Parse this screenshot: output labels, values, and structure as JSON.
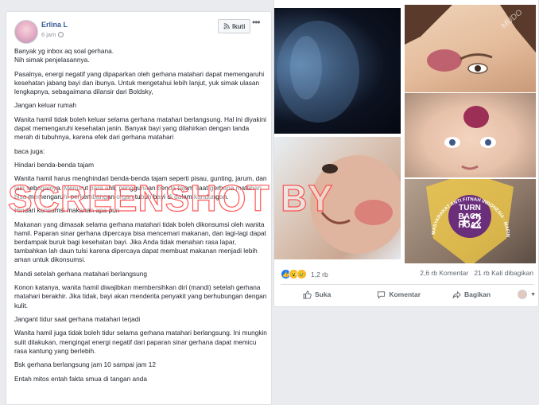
{
  "post": {
    "author": "Erlina L",
    "time": "6 jam",
    "follow_label": "Ikuti",
    "paragraphs": [
      "Banyak yg inbox aq soal gerhana.\nNih simak penjelasannya.",
      "Pasalnya, energi negatif yang dipaparkan oleh gerhana matahari dapat memengaruhi kesehatan jabang bayi dan ibunya. Untuk mengetahui lebih lanjut, yuk simak ulasan lengkapnya, sebagaimana dilansir dari Boldsky,",
      "Jangan keluar rumah",
      "Wanita hamil tidak boleh keluar selama gerhana matahari berlangsung. Hal ini diyakini dapat memengaruhi kesehatan janin. Banyak bayi yang dilahirkan dengan tanda merah di tubuhnya, karena efek dari gerhana matahari",
      "baca juga:",
      "Hindari benda-benda tajam",
      "Wanita hamil harus menghindari benda-benda tajam seperti pisau, gunting, jarum, dan lain sebagainya. Menurut para ahli, penggunaan benda tajam saat gerhana matahari bisa memengaruhi perkembangan organ tubuh bayi di dalam kandungan.",
      "Hindari konsumsi makanan apa pun",
      "Makanan yang dimasak selama gerhana matahari tidak boleh dikonsumsi oleh wanita hamil. Paparan sinar gerhana dipercaya bisa mencemari makanan, dan lagi-lagi dapat berdampak buruk bagi kesehatan bayi. Jika Anda tidak menahan rasa lapar, tambahkan lah daun tulsi karena dipercaya dapat membuat makanan menjadi lebih aman untuk dikonsumsi.",
      "Mandi setelah gerhana matahari berlangsung",
      "Konon katanya, wanita hamil diwajibkan membersihkan diri (mandi) setelah gerhana matahari berakhir. Jika tidak, bayi akan menderita penyakit yang berhubungan dengan kulit.",
      "Jangant tidur saat gerhana matahari terjadi",
      "Wanita hamil juga tidak boleh tidur selama gerhana matahari berlangsung. Ini mungkin sulit dilakukan, mengingat energi negatif dari paparan sinar gerhana dapat memicu rasa kantung yang berlebih.",
      "Bsk gerhana berlangsung jam 10 sampai jam 12",
      "Entah mitos entah fakta smua di tangan anda"
    ]
  },
  "photos": {
    "more_count": "+2",
    "badge_text": "TURN BACK HOAX",
    "seal_text": "MASYARAKAT ANTI FITNAH INDONESIA · MAFINDO",
    "p2_watermark": "MUDO"
  },
  "watermark": "SCREENSHOT BY",
  "stats": {
    "reactions_count": "1,2 rb",
    "comments": "2,6 rb Komentar",
    "shares": "21 rb Kali dibagikan"
  },
  "actions": {
    "like": "Suka",
    "comment": "Komentar",
    "share": "Bagikan"
  },
  "colors": {
    "link": "#385898",
    "like": "#1877f2",
    "watermark_stroke": "#ff3c3c"
  }
}
